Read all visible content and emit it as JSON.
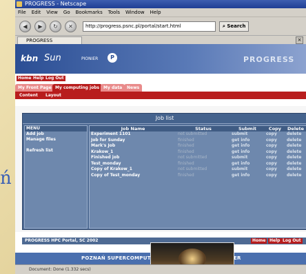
{
  "window": {
    "title": "PROGRESS - Netscape"
  },
  "menubar": [
    "File",
    "Edit",
    "View",
    "Go",
    "Bookmarks",
    "Tools",
    "Window",
    "Help"
  ],
  "toolbar": {
    "url": "http://progress.psnc.pl/portal/start.html",
    "search_label": "Search"
  },
  "browser_tab": {
    "label": "PROGRESS"
  },
  "portal": {
    "logos": {
      "kbn": "kbn",
      "sun": "Sun",
      "pionier": "PIONIER"
    },
    "brand": "PROGRESS",
    "topnav": [
      "Home",
      "Help",
      "Log Out"
    ],
    "tabs": [
      "My Front Page",
      "My computing jobs",
      "My data",
      "News"
    ],
    "active_tab": "My computing jobs",
    "subnav": [
      "Content",
      "Layout"
    ]
  },
  "joblist": {
    "title": "Job list",
    "menu_title": "MENU",
    "menu_items": [
      "Add job",
      "Manage files",
      "Refresh list"
    ],
    "columns": [
      "Job Name",
      "Status",
      "Submit",
      "Copy",
      "Delete"
    ],
    "rows": [
      {
        "name": "Experiment 1101",
        "status": "not submitted",
        "submit": "submit",
        "copy": "copy",
        "delete": "delete"
      },
      {
        "name": "Job for Sunday",
        "status": "finished",
        "submit": "get info",
        "copy": "copy",
        "delete": "delete"
      },
      {
        "name": "Mark's Job",
        "status": "finished",
        "submit": "get info",
        "copy": "copy",
        "delete": "delete"
      },
      {
        "name": "Krakow_1",
        "status": "finished",
        "submit": "get info",
        "copy": "copy",
        "delete": "delete"
      },
      {
        "name": "Finished job",
        "status": "not submitted",
        "submit": "submit",
        "copy": "copy",
        "delete": "delete"
      },
      {
        "name": "Test_monday",
        "status": "finished",
        "submit": "get info",
        "copy": "copy",
        "delete": "delete"
      },
      {
        "name": "Copy of Krakow_1",
        "status": "not submitted",
        "submit": "submit",
        "copy": "copy",
        "delete": "delete"
      },
      {
        "name": "Copy of Test_monday",
        "status": "finished",
        "submit": "get info",
        "copy": "copy",
        "delete": "delete"
      }
    ]
  },
  "footer": {
    "left": "PROGRESS HPC Portal, SC 2002",
    "links": [
      "Home",
      "Help",
      "Log Out"
    ]
  },
  "banner": {
    "text": "POZNAŃ SUPERCOMPUTING AND NETWORKING CENTER"
  },
  "status": {
    "text": "Document: Done (1.332 secs)"
  },
  "slide": {
    "letter": "ń"
  },
  "colors": {
    "portal_red": "#b81d1d",
    "panel_blue": "#4e6a93",
    "header_blue": "#2b4e94"
  }
}
